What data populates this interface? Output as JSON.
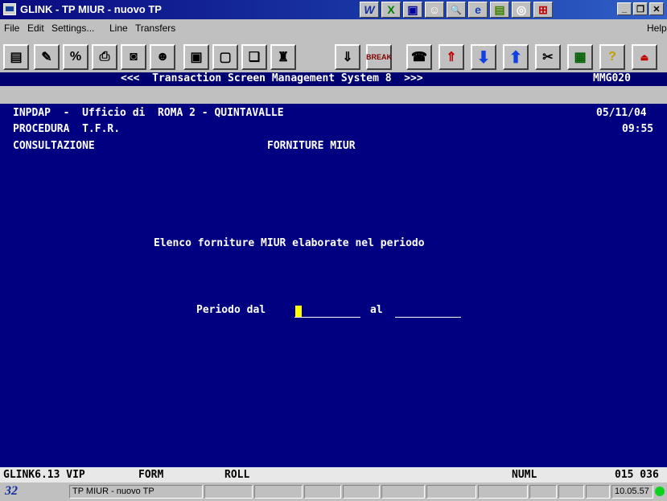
{
  "window": {
    "title": "GLINK - TP MIUR - nuovo TP"
  },
  "title_icons": [
    "W",
    "X",
    "▣",
    "☺",
    "🔍",
    "e",
    "▤",
    "◎",
    "⊞"
  ],
  "menu": {
    "file": "File",
    "edit": "Edit",
    "settings": "Settings...",
    "line": "Line",
    "transfers": "Transfers",
    "help": "Help"
  },
  "toolbar": {
    "break_label": "BREAK"
  },
  "banner": {
    "center": "<<<  Transaction Screen Management System 8  >>>",
    "code": "MMG020"
  },
  "screen": {
    "line1_left": "INPDAP  -  Ufficio di  ROMA 2 - QUINTAVALLE",
    "date": "05/11/04",
    "line2_left": "PROCEDURA  T.F.R.",
    "time": "09:55",
    "line3_left": "CONSULTAZIONE",
    "line3_center": "FORNITURE MIUR",
    "heading": "Elenco forniture MIUR elaborate nel periodo",
    "period_from_label": "Periodo dal",
    "period_from_value": "",
    "period_to_label": "al",
    "period_to_value": ""
  },
  "status": {
    "version": "GLINK6.13 VIP",
    "form": "FORM",
    "roll": "ROLL",
    "numl": "NUML",
    "pos": "015 036"
  },
  "statusbar": {
    "logo": "32",
    "session": "TP MIUR - nuovo TP",
    "clock": "10.05.57"
  }
}
